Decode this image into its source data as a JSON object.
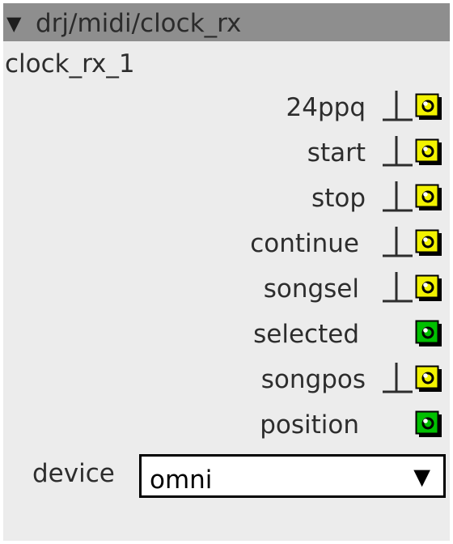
{
  "title_bar": {
    "collapse_glyph": "▼",
    "title": "drj/midi/clock_rx"
  },
  "instance_name": "clock_rx_1",
  "outputs": [
    {
      "label": "24ppq",
      "type": "trigger",
      "color": "#f2f200"
    },
    {
      "label": "start",
      "type": "trigger",
      "color": "#f2f200"
    },
    {
      "label": "stop",
      "type": "trigger",
      "color": "#f2f200"
    },
    {
      "label": "continue",
      "type": "trigger",
      "color": "#f2f200"
    },
    {
      "label": "songsel",
      "type": "trigger",
      "color": "#f2f200"
    },
    {
      "label": "selected",
      "type": "value",
      "color": "#00c000"
    },
    {
      "label": "songpos",
      "type": "trigger",
      "color": "#f2f200"
    },
    {
      "label": "position",
      "type": "value",
      "color": "#00c000"
    }
  ],
  "device": {
    "label": "device",
    "value": "omni",
    "arrow": "▼"
  }
}
